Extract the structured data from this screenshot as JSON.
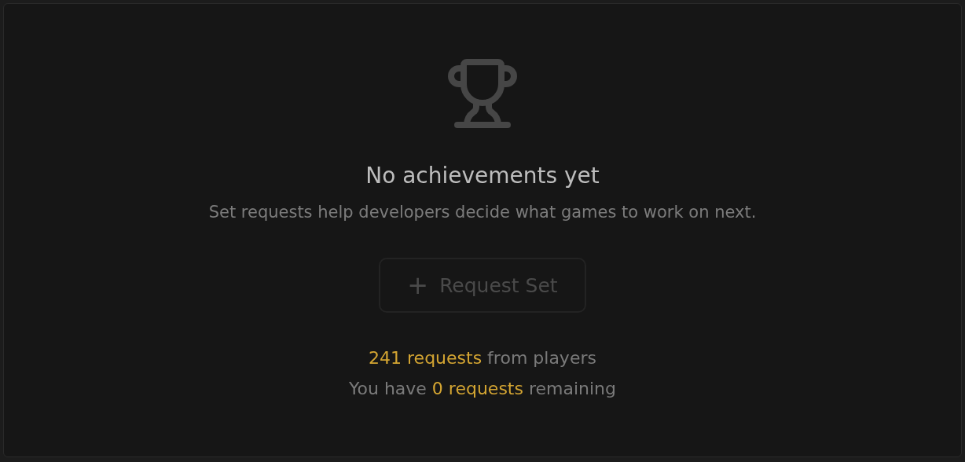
{
  "empty_state": {
    "title": "No achievements yet",
    "description": "Set requests help developers decide what games to work on next.",
    "button": {
      "label": "Request Set",
      "icon": "+",
      "disabled": true
    },
    "stats": [
      [
        {
          "text": "241 requests",
          "highlight": true
        },
        {
          "text": " from players",
          "highlight": false
        }
      ],
      [
        {
          "text": "You have ",
          "highlight": false
        },
        {
          "text": "0 requests",
          "highlight": true
        },
        {
          "text": " remaining",
          "highlight": false
        }
      ]
    ]
  }
}
